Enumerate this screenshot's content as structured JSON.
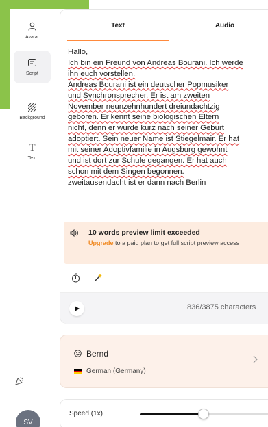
{
  "sidebar": {
    "items": [
      {
        "label": "Avatar",
        "icon": "user-icon"
      },
      {
        "label": "Script",
        "icon": "script-icon"
      },
      {
        "label": "Background",
        "icon": "background-icon"
      },
      {
        "label": "Text",
        "icon": "text-icon"
      }
    ],
    "active": "Script",
    "user_initials": "SV"
  },
  "tabs": [
    {
      "label": "Text",
      "active": true
    },
    {
      "label": "Audio",
      "active": false
    }
  ],
  "script": {
    "lines": [
      "Hallo,",
      "Ich bin ein Freund von Andreas Bourani. Ich werde",
      "ihn euch vorstellen.",
      "Andreas Bourani ist ein deutscher Popmusiker",
      "und Synchronsprecher. Er ist am zweiten",
      "November neunzehnhundert dreiundachtzig",
      "geboren. Er kennt seine biologischen Eltern",
      "nicht, denn er wurde kurz nach seiner Geburt",
      "adoptiert. Sein neuer Name ist Stiegelmair. Er hat",
      "mit seiner Adoptivfamilie in Augsburg gewohnt",
      "und ist dort zur Schule gegangen. Er hat auch",
      "schon mit dem Singen begonnen.",
      "zweitausendacht ist er dann nach Berlin"
    ]
  },
  "warning": {
    "title": "10 words preview limit exceeded",
    "upgrade": "Upgrade",
    "body": " to a paid plan to get full script preview access"
  },
  "player": {
    "char_count": "836/3875 characters"
  },
  "voice": {
    "name": "Bernd",
    "language": "German (Germany)"
  },
  "speed": {
    "label": "Speed (1x)",
    "value_fraction": 0.49
  },
  "colors": {
    "accent": "#ff8a3d",
    "upgrade": "#f08a24",
    "warn_bg": "#fdece0",
    "brand_green": "#8bc34a"
  }
}
